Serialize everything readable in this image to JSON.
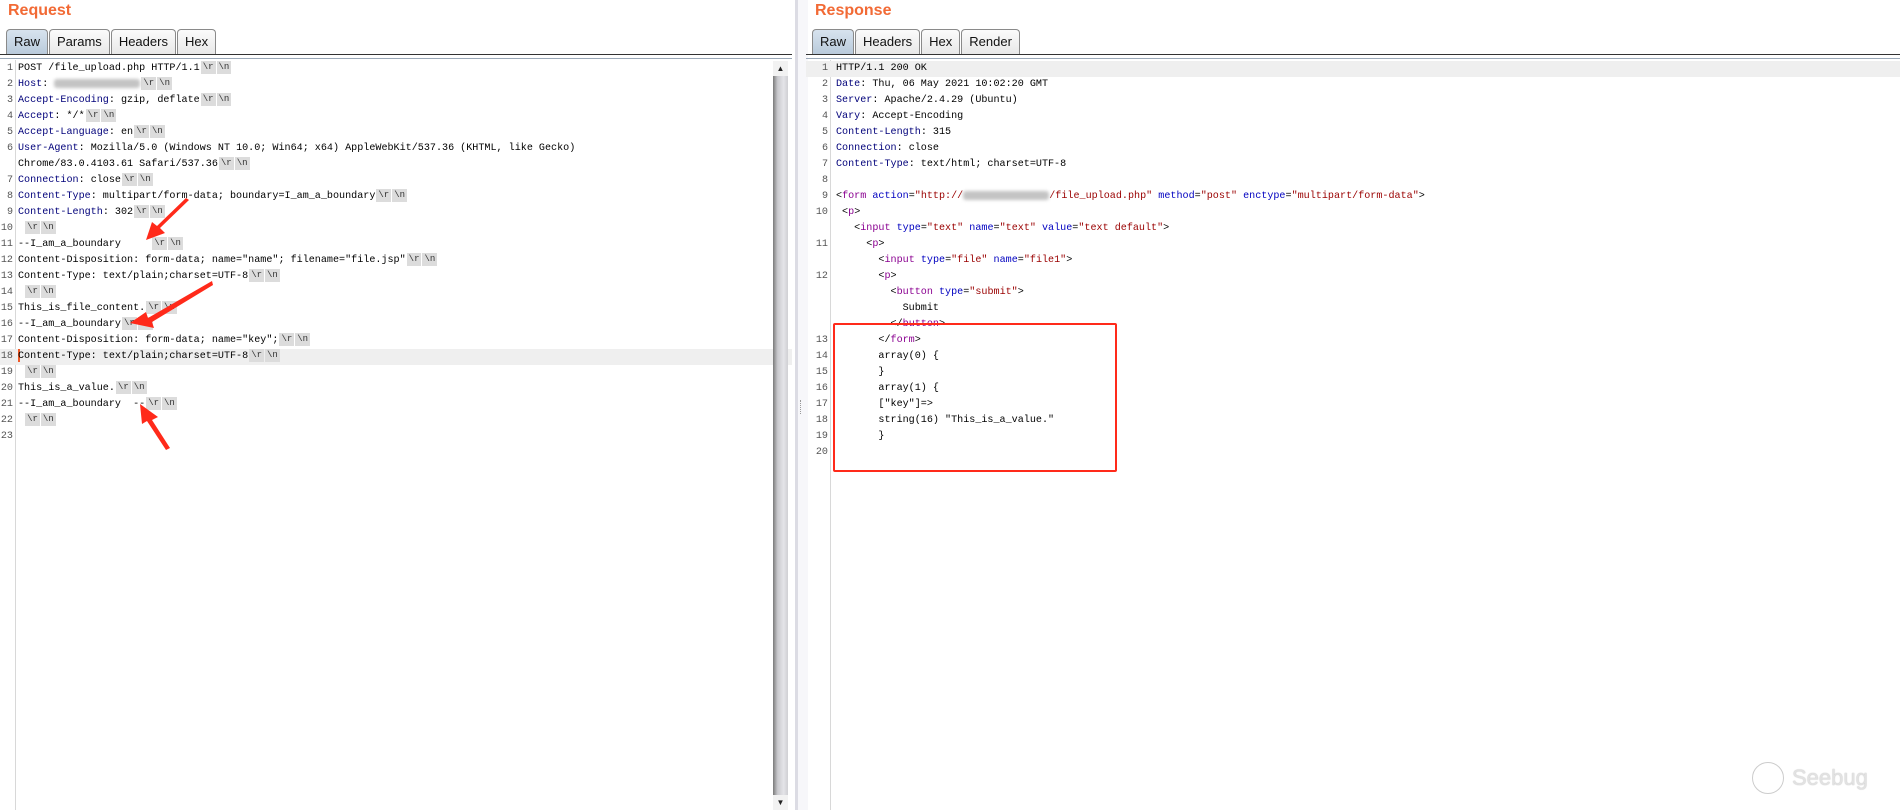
{
  "request": {
    "title": "Request",
    "tabs": [
      {
        "label": "Raw",
        "selected": true
      },
      {
        "label": "Params"
      },
      {
        "label": "Headers"
      },
      {
        "label": "Hex"
      }
    ],
    "crlf_marks": [
      "\\r",
      "\\n"
    ],
    "rows": [
      {
        "num": "1",
        "crlf": true,
        "segs": [
          [
            "p",
            "POST /file_upload.php HTTP/1.1"
          ]
        ]
      },
      {
        "num": "2",
        "crlf": true,
        "segs": [
          [
            "h",
            "Host"
          ],
          [
            "p",
            ": "
          ],
          [
            "blur",
            ""
          ]
        ]
      },
      {
        "num": "3",
        "crlf": true,
        "segs": [
          [
            "h",
            "Accept-Encoding"
          ],
          [
            "p",
            ": gzip, deflate"
          ]
        ]
      },
      {
        "num": "4",
        "crlf": true,
        "segs": [
          [
            "h",
            "Accept"
          ],
          [
            "p",
            ": */*"
          ]
        ]
      },
      {
        "num": "5",
        "crlf": true,
        "segs": [
          [
            "h",
            "Accept-Language"
          ],
          [
            "p",
            ": en"
          ]
        ]
      },
      {
        "num": "6",
        "crlf": false,
        "segs": [
          [
            "h",
            "User-Agent"
          ],
          [
            "p",
            ": Mozilla/5.0 (Windows NT 10.0; Win64; x64) AppleWebKit/537.36 (KHTML, like Gecko)"
          ]
        ]
      },
      {
        "num": "",
        "crlf": true,
        "segs": [
          [
            "p",
            "Chrome/83.0.4103.61 Safari/537.36"
          ]
        ]
      },
      {
        "num": "7",
        "crlf": true,
        "segs": [
          [
            "h",
            "Connection"
          ],
          [
            "p",
            ": close"
          ]
        ]
      },
      {
        "num": "8",
        "crlf": true,
        "segs": [
          [
            "h",
            "Content-Type"
          ],
          [
            "p",
            ": multipart/form-data; boundary=I_am_a_boundary"
          ]
        ]
      },
      {
        "num": "9",
        "crlf": true,
        "segs": [
          [
            "h",
            "Content-Length"
          ],
          [
            "p",
            ": 302"
          ]
        ]
      },
      {
        "num": "10",
        "crlf": true,
        "segs": [
          [
            "p",
            " "
          ]
        ]
      },
      {
        "num": "11",
        "crlf": true,
        "segs": [
          [
            "p",
            "--I_am_a_boundary     "
          ]
        ]
      },
      {
        "num": "12",
        "crlf": true,
        "segs": [
          [
            "p",
            "Content-Disposition: form-data; name=\"name\"; filename=\"file.jsp\""
          ]
        ]
      },
      {
        "num": "13",
        "crlf": true,
        "segs": [
          [
            "p",
            "Content-Type: text/plain;charset=UTF-8"
          ]
        ]
      },
      {
        "num": "14",
        "crlf": true,
        "segs": [
          [
            "p",
            " "
          ]
        ]
      },
      {
        "num": "15",
        "crlf": true,
        "segs": [
          [
            "p",
            "This_is_file_content."
          ]
        ]
      },
      {
        "num": "16",
        "crlf": true,
        "segs": [
          [
            "p",
            "--I_am_a_boundary"
          ]
        ]
      },
      {
        "num": "17",
        "crlf": true,
        "segs": [
          [
            "p",
            "Content-Disposition: form-data; name=\"key\";"
          ]
        ]
      },
      {
        "num": "18",
        "crlf": true,
        "highlight": true,
        "caret": true,
        "segs": [
          [
            "p",
            "Content-Type: text/plain;charset=UTF-8"
          ]
        ]
      },
      {
        "num": "19",
        "crlf": true,
        "segs": [
          [
            "p",
            " "
          ]
        ]
      },
      {
        "num": "20",
        "crlf": true,
        "segs": [
          [
            "p",
            "This_is_a_value."
          ]
        ]
      },
      {
        "num": "21",
        "crlf": true,
        "segs": [
          [
            "p",
            "--I_am_a_boundary  --"
          ]
        ]
      },
      {
        "num": "22",
        "crlf": true,
        "segs": [
          [
            "p",
            " "
          ]
        ]
      },
      {
        "num": "23",
        "crlf": false,
        "segs": []
      }
    ]
  },
  "response": {
    "title": "Response",
    "tabs": [
      {
        "label": "Raw",
        "selected": true
      },
      {
        "label": "Headers"
      },
      {
        "label": "Hex"
      },
      {
        "label": "Render"
      }
    ],
    "rows": [
      {
        "num": "1",
        "highlight": true,
        "segs": [
          [
            "p",
            "HTTP/1.1 200 OK"
          ]
        ]
      },
      {
        "num": "2",
        "segs": [
          [
            "h",
            "Date"
          ],
          [
            "p",
            ": Thu, 06 May 2021 10:02:20 GMT"
          ]
        ]
      },
      {
        "num": "3",
        "segs": [
          [
            "h",
            "Server"
          ],
          [
            "p",
            ": Apache/2.4.29 (Ubuntu)"
          ]
        ]
      },
      {
        "num": "4",
        "segs": [
          [
            "h",
            "Vary"
          ],
          [
            "p",
            ": Accept-Encoding"
          ]
        ]
      },
      {
        "num": "5",
        "segs": [
          [
            "h",
            "Content-Length"
          ],
          [
            "p",
            ": 315"
          ]
        ]
      },
      {
        "num": "6",
        "segs": [
          [
            "h",
            "Connection"
          ],
          [
            "p",
            ": close"
          ]
        ]
      },
      {
        "num": "7",
        "segs": [
          [
            "h",
            "Content-Type"
          ],
          [
            "p",
            ": text/html; charset=UTF-8"
          ]
        ]
      },
      {
        "num": "8",
        "segs": []
      },
      {
        "num": "9",
        "segs": [
          [
            "p",
            "<"
          ],
          [
            "tg",
            "form"
          ],
          [
            "p",
            " "
          ],
          [
            "at",
            "action"
          ],
          [
            "p",
            "="
          ],
          [
            "vl",
            "\"http://"
          ],
          [
            "blur",
            ""
          ],
          [
            "vl",
            "/file_upload.php\""
          ],
          [
            "p",
            " "
          ],
          [
            "at",
            "method"
          ],
          [
            "p",
            "="
          ],
          [
            "vl",
            "\"post\""
          ],
          [
            "p",
            " "
          ],
          [
            "at",
            "enctype"
          ],
          [
            "p",
            "="
          ],
          [
            "vl",
            "\"multipart/form-data\""
          ],
          [
            "p",
            ">"
          ]
        ]
      },
      {
        "num": "10",
        "segs": [
          [
            "p",
            " <"
          ],
          [
            "tg",
            "p"
          ],
          [
            "p",
            ">"
          ]
        ]
      },
      {
        "num": "",
        "segs": [
          [
            "p",
            "   <"
          ],
          [
            "tg",
            "input"
          ],
          [
            "p",
            " "
          ],
          [
            "at",
            "type"
          ],
          [
            "p",
            "="
          ],
          [
            "vl",
            "\"text\""
          ],
          [
            "p",
            " "
          ],
          [
            "at",
            "name"
          ],
          [
            "p",
            "="
          ],
          [
            "vl",
            "\"text\""
          ],
          [
            "p",
            " "
          ],
          [
            "at",
            "value"
          ],
          [
            "p",
            "="
          ],
          [
            "vl",
            "\"text default\""
          ],
          [
            "p",
            ">"
          ]
        ]
      },
      {
        "num": "11",
        "segs": [
          [
            "p",
            "     <"
          ],
          [
            "tg",
            "p"
          ],
          [
            "p",
            ">"
          ]
        ]
      },
      {
        "num": "",
        "segs": [
          [
            "p",
            "       <"
          ],
          [
            "tg",
            "input"
          ],
          [
            "p",
            " "
          ],
          [
            "at",
            "type"
          ],
          [
            "p",
            "="
          ],
          [
            "vl",
            "\"file\""
          ],
          [
            "p",
            " "
          ],
          [
            "at",
            "name"
          ],
          [
            "p",
            "="
          ],
          [
            "vl",
            "\"file1\""
          ],
          [
            "p",
            ">"
          ]
        ]
      },
      {
        "num": "12",
        "segs": [
          [
            "p",
            "       <"
          ],
          [
            "tg",
            "p"
          ],
          [
            "p",
            ">"
          ]
        ]
      },
      {
        "num": "",
        "segs": [
          [
            "p",
            "         <"
          ],
          [
            "tg",
            "button"
          ],
          [
            "p",
            " "
          ],
          [
            "at",
            "type"
          ],
          [
            "p",
            "="
          ],
          [
            "vl",
            "\"submit\""
          ],
          [
            "p",
            ">"
          ]
        ]
      },
      {
        "num": "",
        "segs": [
          [
            "p",
            "           Submit"
          ]
        ]
      },
      {
        "num": "",
        "segs": [
          [
            "p",
            "         </"
          ],
          [
            "tg",
            "button"
          ],
          [
            "p",
            ">"
          ]
        ]
      },
      {
        "num": "13",
        "segs": [
          [
            "p",
            "       </"
          ],
          [
            "tg",
            "form"
          ],
          [
            "p",
            ">"
          ]
        ]
      },
      {
        "num": "14",
        "segs": [
          [
            "p",
            "       array(0) {"
          ]
        ]
      },
      {
        "num": "15",
        "segs": [
          [
            "p",
            "       }"
          ]
        ]
      },
      {
        "num": "16",
        "segs": [
          [
            "p",
            "       array(1) {"
          ]
        ]
      },
      {
        "num": "17",
        "segs": [
          [
            "p",
            "       [\"key\"]=>"
          ]
        ]
      },
      {
        "num": "18",
        "segs": [
          [
            "p",
            "       string(16) \"This_is_a_value.\""
          ]
        ]
      },
      {
        "num": "19",
        "segs": [
          [
            "p",
            "       }"
          ]
        ]
      },
      {
        "num": "20",
        "segs": []
      }
    ]
  },
  "watermark": {
    "text": "Seebug"
  },
  "colors": {
    "title": "#f26a35",
    "annotation": "#ff2a1a",
    "header_name": "#00007a",
    "tag": "#8a0090",
    "attr": "#0000c0",
    "value": "#9a0000"
  }
}
